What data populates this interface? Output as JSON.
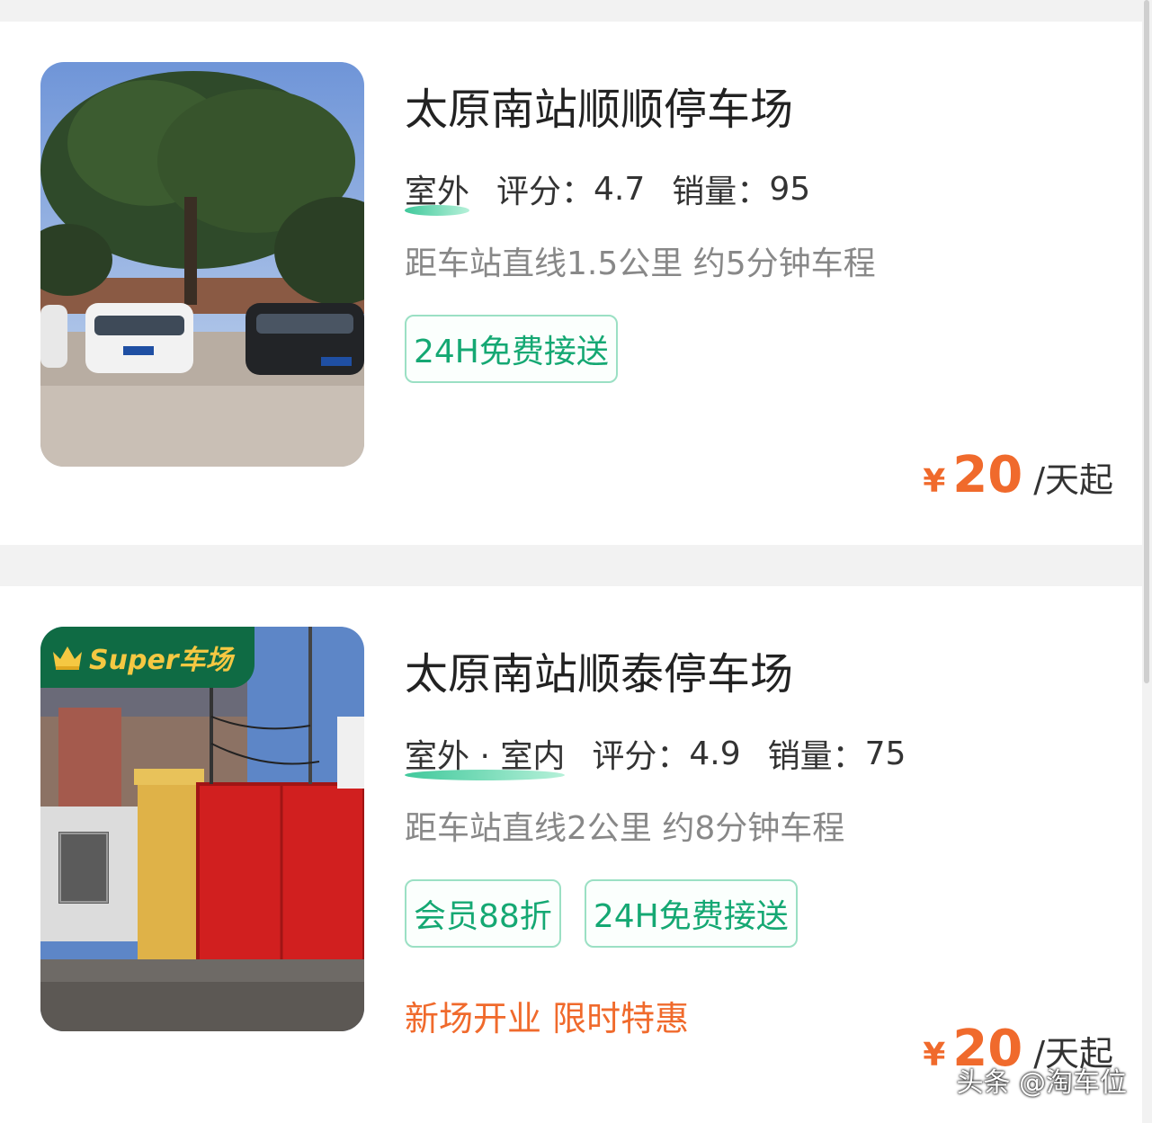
{
  "listings": [
    {
      "name": "太原南站顺顺停车场",
      "type": "室外",
      "rating_label": "评分：",
      "rating": "4.7",
      "sales_label": "销量：",
      "sales": "95",
      "distance": "距车站直线1.5公里 约5分钟车程",
      "tags": [
        "24H免费接送"
      ],
      "currency": "¥",
      "price": "20",
      "price_unit": "/天起"
    },
    {
      "badge": "Super车场",
      "name": "太原南站顺泰停车场",
      "type": "室外 · 室内",
      "rating_label": "评分：",
      "rating": "4.9",
      "sales_label": "销量：",
      "sales": "75",
      "distance": "距车站直线2公里 约8分钟车程",
      "tags": [
        "会员88折",
        "24H免费接送"
      ],
      "promo": "新场开业 限时特惠",
      "currency": "¥",
      "price": "20",
      "price_unit": "/天起"
    }
  ],
  "watermark": "头条 @淘车位",
  "colors": {
    "accent_green": "#15a873",
    "price_orange": "#f06a2c",
    "badge_green": "#0f6b44",
    "badge_gold": "#f5c842"
  }
}
